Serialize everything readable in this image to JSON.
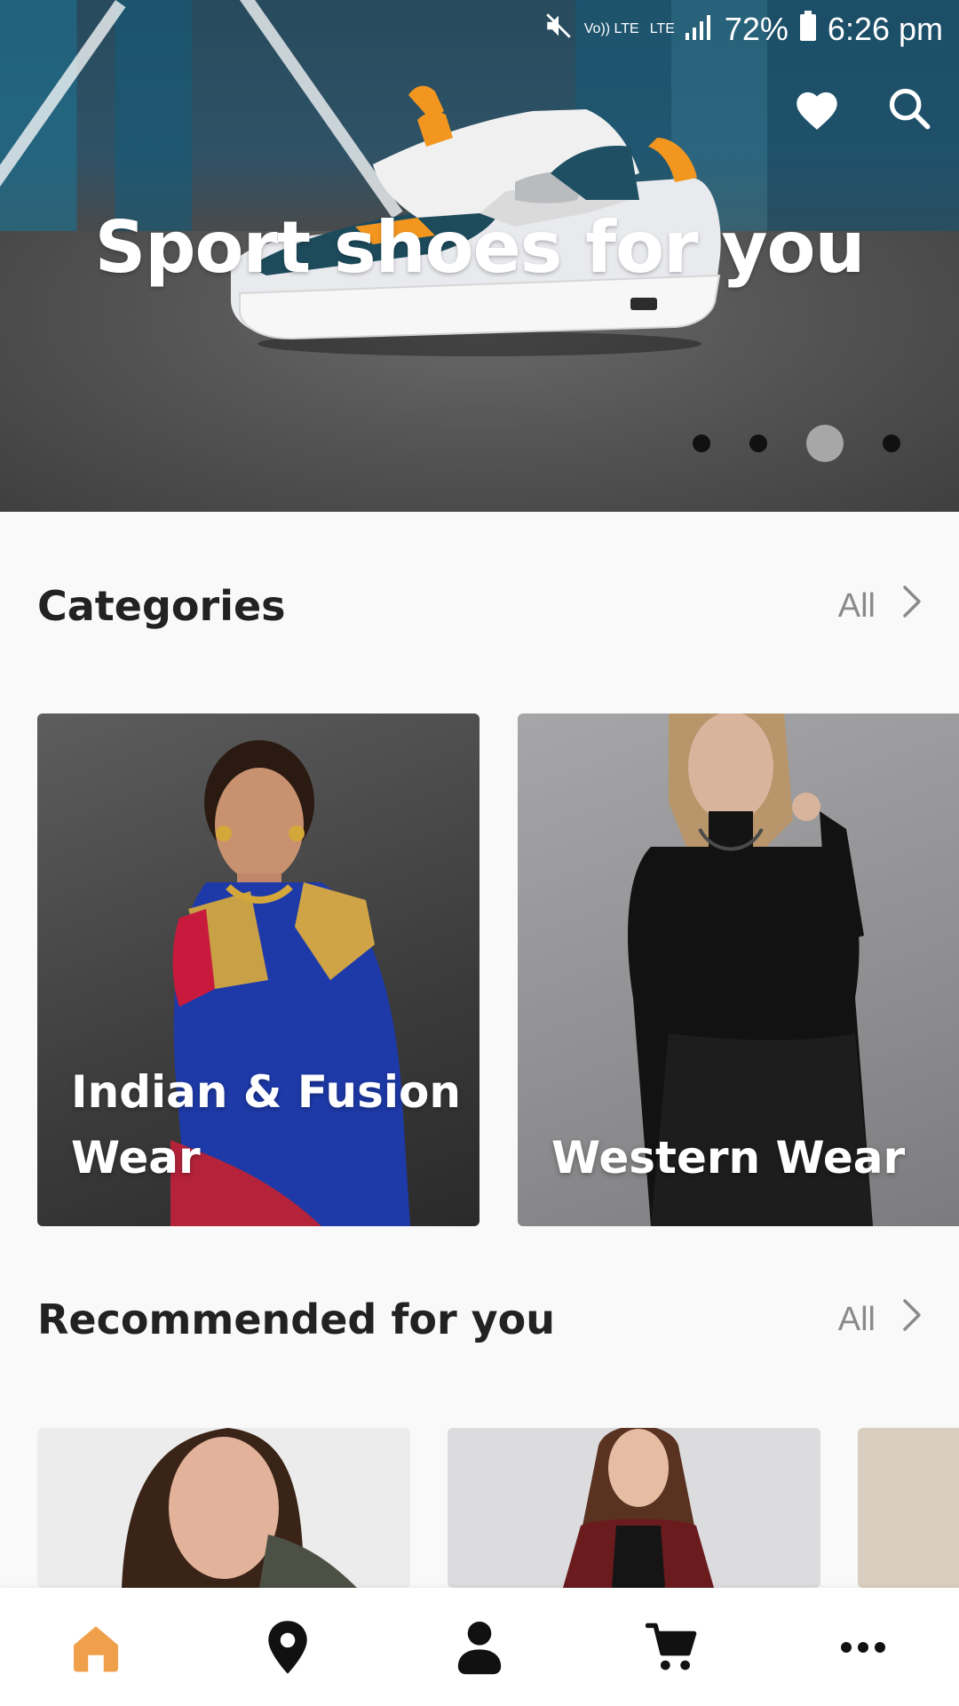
{
  "status_bar": {
    "volte": "Vo)) LTE",
    "lte": "LTE",
    "battery": "72%",
    "time": "6:26 pm"
  },
  "hero": {
    "title": "Sport shoes for you",
    "slides": {
      "count": 4,
      "active_index": 2
    }
  },
  "categories": {
    "title": "Categories",
    "see_all": "All",
    "items": [
      {
        "line1": "Indian & Fusion",
        "line2": "Wear"
      },
      {
        "line1": "",
        "line2": "Western Wear"
      }
    ]
  },
  "recommended": {
    "title": "Recommended for you",
    "see_all": "All"
  },
  "colors": {
    "accent": "#f0a04b",
    "title": "#222222",
    "muted": "#8a8a8a",
    "background": "#f9f9f9"
  },
  "bottom_nav": {
    "items": [
      "home-icon",
      "location-pin-icon",
      "profile-icon",
      "cart-icon",
      "more-icon"
    ],
    "active": "home-icon"
  }
}
